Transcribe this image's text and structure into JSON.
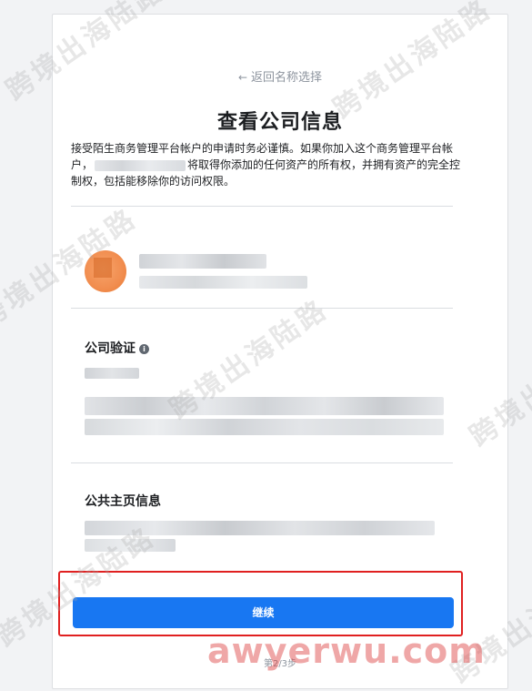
{
  "back_link": {
    "label": "返回名称选择"
  },
  "page_title": "查看公司信息",
  "description": {
    "part1": "接受陌生商务管理平台帐户的申请时务必谨慎。如果你加入这个商务管理平台帐户，",
    "part2": "将取得你添加的任何资产的所有权，并拥有资产的完全控制权，包括能移除你的访问权限。"
  },
  "company_verification": {
    "title": "公司验证"
  },
  "public_page_info": {
    "title": "公共主页信息"
  },
  "continue_button": {
    "label": "继续"
  },
  "step_indicator": "第2/3步",
  "watermarks": {
    "text": "跨境出海陆路",
    "site": "awyerwu.com"
  },
  "colors": {
    "primary": "#1877f2",
    "highlight": "#e02020",
    "avatar": "#f18d4f"
  }
}
